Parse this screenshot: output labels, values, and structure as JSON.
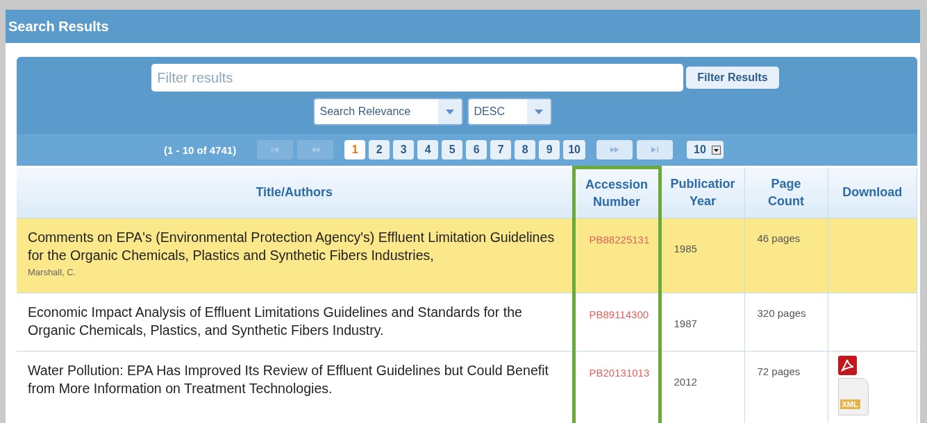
{
  "panel": {
    "title": "Search Results"
  },
  "filter": {
    "placeholder": "Filter results",
    "button": "Filter Results"
  },
  "sort": {
    "field": "Search Relevance",
    "order": "DESC"
  },
  "pager": {
    "summary": "(1 - 10 of 4741)",
    "first_disabled": true,
    "prev_disabled": true,
    "next_disabled": false,
    "last_disabled": false,
    "pages": [
      {
        "label": "1",
        "selected": true
      },
      {
        "label": "2",
        "selected": false
      },
      {
        "label": "3",
        "selected": false
      },
      {
        "label": "4",
        "selected": false
      },
      {
        "label": "5",
        "selected": false
      },
      {
        "label": "6",
        "selected": false
      },
      {
        "label": "7",
        "selected": false
      },
      {
        "label": "8",
        "selected": false
      },
      {
        "label": "9",
        "selected": false
      },
      {
        "label": "10",
        "selected": false
      }
    ],
    "per_page": "10"
  },
  "table": {
    "columns": [
      {
        "label": "Title/Authors",
        "highlighted": false
      },
      {
        "label": "Accession Number",
        "highlighted": true
      },
      {
        "label": "Publicatior Year",
        "highlighted": false
      },
      {
        "label": "Page Count",
        "highlighted": false
      },
      {
        "label": "Download",
        "highlighted": false
      }
    ],
    "rows": [
      {
        "selected": true,
        "title": "Comments on EPA's (Environmental Protection Agency's) Effluent Limitation Guidelines for the Organic Chemicals, Plastics and Synthetic Fibers Industries,",
        "author": "Marshall, C.",
        "accession": "PB88225131",
        "year": "1985",
        "pages": "46 pages",
        "downloads": []
      },
      {
        "selected": false,
        "title": "Economic Impact Analysis of Effluent Limitations Guidelines and Standards for the Organic Chemicals, Plastics, and Synthetic Fibers Industry.",
        "accession": "PB89114300",
        "year": "1987",
        "pages": "320 pages",
        "downloads": []
      },
      {
        "selected": false,
        "title": "Water Pollution: EPA Has Improved Its Review of Effluent Guidelines but Could Benefit from More Information on Treatment Technologies.",
        "accession": "PB20131013",
        "year": "2012",
        "pages": "72 pages",
        "downloads": [
          {
            "kind": "pdf"
          },
          {
            "kind": "xml",
            "label": "XML"
          }
        ]
      }
    ]
  }
}
